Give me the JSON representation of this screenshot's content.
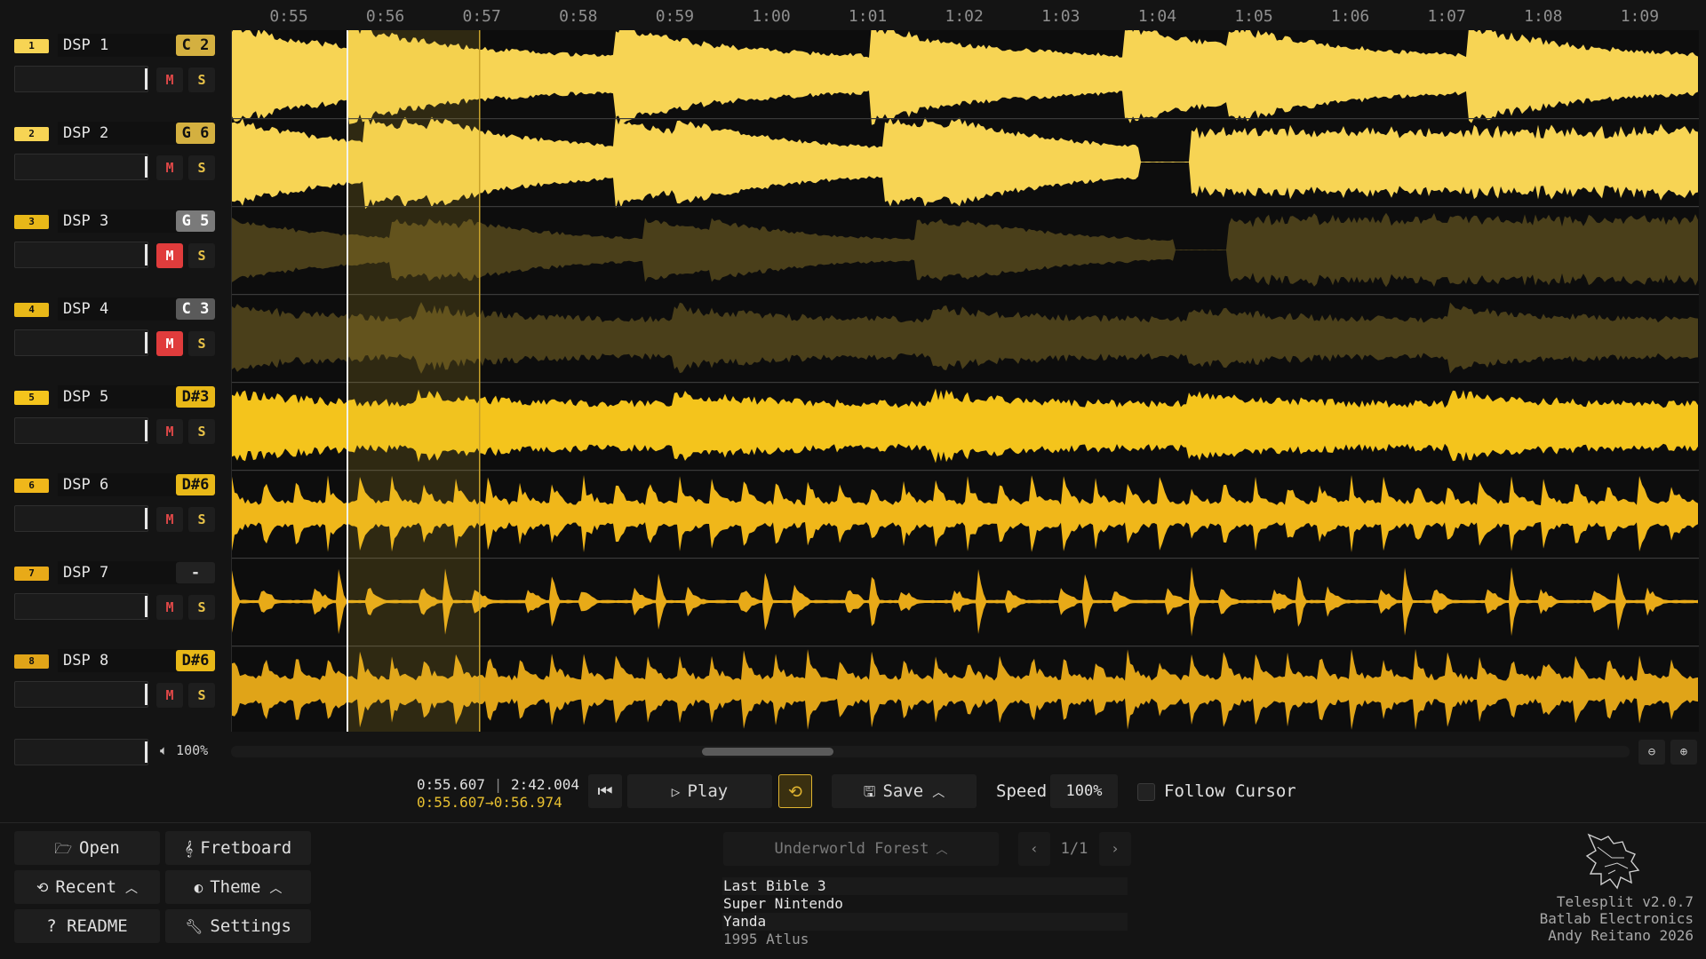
{
  "timeline": {
    "ticks": [
      "0:55",
      "0:56",
      "0:57",
      "0:58",
      "0:59",
      "1:00",
      "1:01",
      "1:02",
      "1:03",
      "1:04",
      "1:05",
      "1:06",
      "1:07",
      "1:08",
      "1:09"
    ]
  },
  "tracks": [
    {
      "num": "1",
      "name": "DSP 1",
      "note": "C 2",
      "muted": false,
      "volume": 1.0,
      "color": "#f7d454"
    },
    {
      "num": "2",
      "name": "DSP 2",
      "note": "G 6",
      "muted": false,
      "volume": 1.0,
      "color": "#f7d454"
    },
    {
      "num": "3",
      "name": "DSP 3",
      "note": "G 5",
      "muted": true,
      "volume": 1.0,
      "color": "#4a3f1a"
    },
    {
      "num": "4",
      "name": "DSP 4",
      "note": "C 3",
      "muted": true,
      "volume": 1.0,
      "color": "#4a3f1a"
    },
    {
      "num": "5",
      "name": "DSP 5",
      "note": "D#3",
      "muted": false,
      "volume": 1.0,
      "color": "#f4c41c"
    },
    {
      "num": "6",
      "name": "DSP 6",
      "note": "D#6",
      "muted": false,
      "volume": 1.0,
      "color": "#f0b71a"
    },
    {
      "num": "7",
      "name": "DSP 7",
      "note": "-",
      "muted": false,
      "volume": 1.0,
      "color": "#e8aa18"
    },
    {
      "num": "8",
      "name": "DSP 8",
      "note": "D#6",
      "muted": false,
      "volume": 1.0,
      "color": "#e0a418"
    }
  ],
  "labels": {
    "mute": "M",
    "solo": "S"
  },
  "master": {
    "volume_label": "100%",
    "volume": 1.0
  },
  "transport": {
    "position": "0:55.607",
    "duration": "2:42.004",
    "loop_range": "0:55.607→0:56.974",
    "play_label": "Play",
    "save_label": "Save",
    "speed_label": "Speed",
    "speed_value": "100%",
    "follow_label": "Follow Cursor"
  },
  "menu": {
    "open": "Open",
    "fretboard": "Fretboard",
    "recent": "Recent",
    "theme": "Theme",
    "readme": "? README",
    "settings": "Settings"
  },
  "song": {
    "title": "Underworld Forest",
    "page": "1/1",
    "info": [
      "Last Bible 3",
      "Super Nintendo",
      "Yanda",
      "1995 Atlus"
    ]
  },
  "credits": {
    "line1": "Telesplit v2.0.7",
    "line2": "Batlab Electronics",
    "line3": "Andy Reitano 2026"
  },
  "colors": {
    "accent": "#e8c030",
    "mute_on": "#e03c3c",
    "background": "#141414"
  }
}
